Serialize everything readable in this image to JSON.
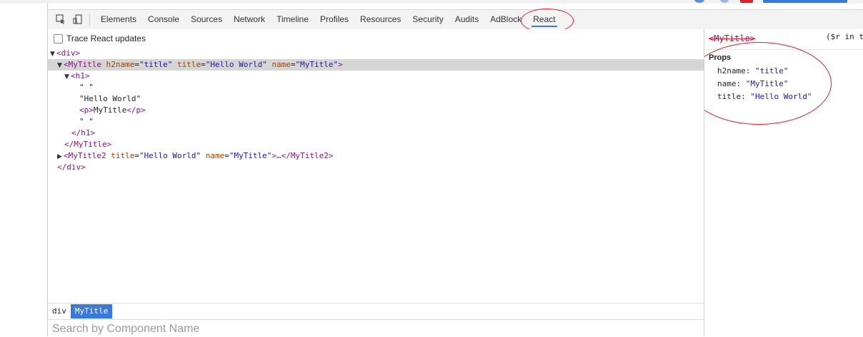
{
  "toolbar": {
    "tabs": [
      "Elements",
      "Console",
      "Sources",
      "Network",
      "Timeline",
      "Profiles",
      "Resources",
      "Security",
      "Audits",
      "AdBlock",
      "React"
    ],
    "active_tab": "React",
    "icons": [
      "inspect-element-icon",
      "device-mode-icon"
    ]
  },
  "react_panel": {
    "trace_label": "Trace React updates",
    "tree": {
      "div_open": "<div>",
      "mytitle_tag": "<MyTitle",
      "attr_h2name": "h2name",
      "attr_h2name_val": "\"title\"",
      "attr_title": "title",
      "attr_title_val": "\"Hello World\"",
      "attr_name": "name",
      "attr_name_val": "\"MyTitle\"",
      "close_gt": ">",
      "h1_open": "<h1>",
      "text1": "\" \"",
      "text_hello": "\"Hello World\"",
      "p_open": "<p>",
      "p_text": "MyTitle",
      "p_close": "</p>",
      "text2": "\" \"",
      "h1_close": "</h1>",
      "mytitle_close": "</MyTitle>",
      "mytitle2_tag": "<MyTitle2",
      "mytitle2_title": "title",
      "mytitle2_title_val": "\"Hello World\"",
      "mytitle2_name": "name",
      "mytitle2_name_val": "\"MyTitle\"",
      "mytitle2_rest": ">…",
      "mytitle2_close": "</MyTitle2>",
      "div_close": "</div>"
    },
    "breadcrumb": [
      "div",
      "MyTitle"
    ],
    "search": {
      "placeholder": "Search by Component Name",
      "value": ""
    }
  },
  "side_panel": {
    "title": "<MyTitle>",
    "hint": "($r in t",
    "props_heading": "Props",
    "props": [
      {
        "key": "h2name:",
        "value": "\"title\""
      },
      {
        "key": "name:",
        "value": "\"MyTitle\""
      },
      {
        "key": "title:",
        "value": "\"Hello World\""
      }
    ]
  },
  "colors": {
    "tag": "#881280",
    "attr_name": "#994500",
    "attr_value": "#1a1aa6",
    "selected_row": "#d5d5d5",
    "active_accent": "#3879d9",
    "annotation_circle": "#e0202a"
  }
}
